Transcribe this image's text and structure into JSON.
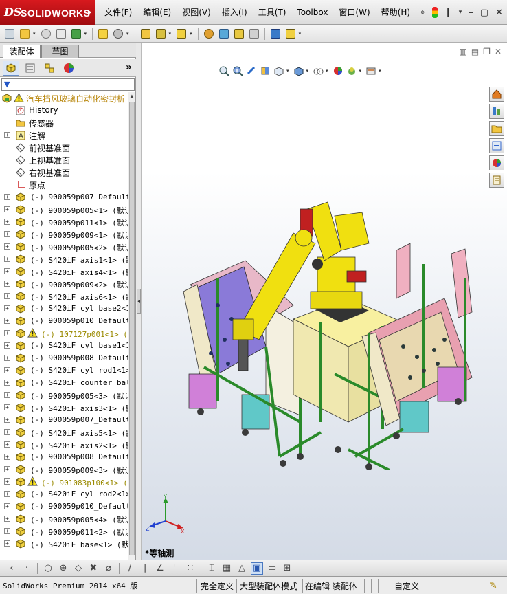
{
  "app": {
    "logo_text": "SOLIDWORKS",
    "logo_mark": "DS"
  },
  "menu": [
    "文件(F)",
    "编辑(E)",
    "视图(V)",
    "插入(I)",
    "工具(T)",
    "Toolbox",
    "窗口(W)",
    "帮助(H)"
  ],
  "panel_tabs": {
    "assembly": "装配体",
    "sketch": "草图"
  },
  "tree": {
    "top_item": "汽车挡风玻璃自动化密封析",
    "items": [
      {
        "label": "History",
        "type": "history"
      },
      {
        "label": "传感器",
        "type": "sensor"
      },
      {
        "label": "注解",
        "type": "annotation",
        "expand": true
      },
      {
        "label": "前视基准面",
        "type": "plane"
      },
      {
        "label": "上视基准面",
        "type": "plane"
      },
      {
        "label": "右视基准面",
        "type": "plane"
      },
      {
        "label": "原点",
        "type": "origin"
      },
      {
        "label": "(-) 900059p007_Default_",
        "type": "part"
      },
      {
        "label": "(-) 900059p005<1> (默认",
        "type": "part"
      },
      {
        "label": "(-) 900059p011<1> (默认",
        "type": "part"
      },
      {
        "label": "(-) 900059p009<1> (默认",
        "type": "part"
      },
      {
        "label": "(-) 900059p005<2> (默认",
        "type": "part"
      },
      {
        "label": "(-) S420iF axis1<1> (默认",
        "type": "part"
      },
      {
        "label": "(-) S420iF axis4<1> (默认",
        "type": "part"
      },
      {
        "label": "(-) 900059p009<2> (默认",
        "type": "part"
      },
      {
        "label": "(-) S420iF axis6<1> (默认",
        "type": "part"
      },
      {
        "label": "(-) S420iF cyl base2<1>",
        "type": "part"
      },
      {
        "label": "(-) 900059p010_Default_",
        "type": "part"
      },
      {
        "label": "(-) 107127p001<1> (默",
        "type": "subasm-warn"
      },
      {
        "label": "(-) S420iF cyl base1<1>",
        "type": "part"
      },
      {
        "label": "(-) 900059p008_Default_",
        "type": "part"
      },
      {
        "label": "(-) S420iF cyl rod1<1>",
        "type": "part"
      },
      {
        "label": "(-) S420iF counter bal<",
        "type": "part"
      },
      {
        "label": "(-) 900059p005<3> (默认",
        "type": "part"
      },
      {
        "label": "(-) S420iF axis3<1> (默认",
        "type": "part"
      },
      {
        "label": "(-) 900059p007_Default_",
        "type": "part"
      },
      {
        "label": "(-) S420iF axis5<1> (默认",
        "type": "part"
      },
      {
        "label": "(-) S420iF axis2<1> (默认",
        "type": "part"
      },
      {
        "label": "(-) 900059p008_Default_",
        "type": "part"
      },
      {
        "label": "(-) 900059p009<3> (默认",
        "type": "part"
      },
      {
        "label": "(-) 901083p100<1> (默",
        "type": "subasm-warn"
      },
      {
        "label": "(-) S420iF cyl rod2<1>",
        "type": "part"
      },
      {
        "label": "(-) 900059p010_Default_",
        "type": "part"
      },
      {
        "label": "(-) 900059p005<4> (默认",
        "type": "part"
      },
      {
        "label": "(-) 900059p011<2> (默认",
        "type": "part"
      },
      {
        "label": "(-) S420iF base<1> (默认",
        "type": "part"
      }
    ]
  },
  "viewport": {
    "view_name": "*等轴测",
    "triad": {
      "x": "X",
      "y": "Y",
      "z": "Z"
    }
  },
  "statusbar": {
    "app": "SolidWorks Premium 2014 x64 版",
    "definition": "完全定义",
    "mode": "大型装配体模式",
    "editing": "在编辑 装配体",
    "units": "自定义"
  },
  "colors": {
    "logo_red": "#c8141a",
    "robot_yellow": "#f0e010",
    "fixture_pink": "#d890a8",
    "fixture_green": "#58a858",
    "fixture_cyan": "#60c8c8",
    "fixture_magenta": "#d080d8"
  }
}
